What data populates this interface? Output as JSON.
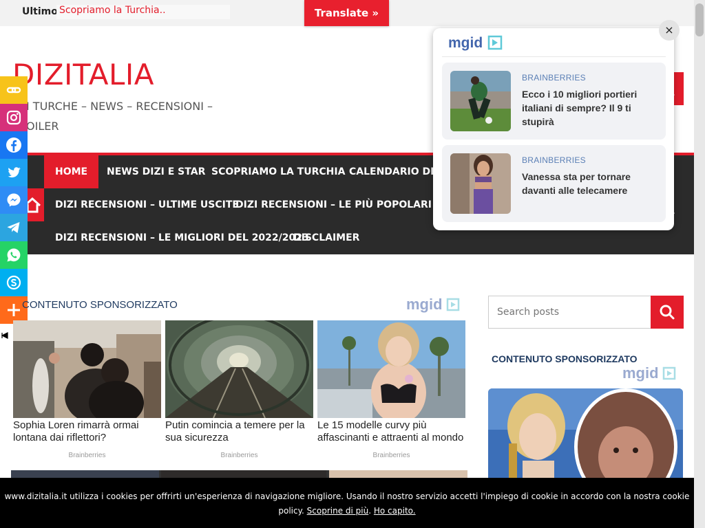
{
  "topbar": {
    "ticker_label": "Ultimo:",
    "ticker_link": "Scopriamo la Turchia..",
    "translate_label": "Translate »"
  },
  "header": {
    "logo": "DIZITALIA",
    "tagline_line1": "I TURCHE – NEWS – RECENSIONI –",
    "tagline_line2": "OILER"
  },
  "nav": {
    "items": [
      {
        "label": "HOME"
      },
      {
        "label": "NEWS DIZI E STAR"
      },
      {
        "label": "SCOPRIAMO LA TURCHIA"
      },
      {
        "label": "CALENDARIO DIZI TU"
      },
      {
        "label": "DIZI RECENSIONI – ULTIME USCITE"
      },
      {
        "label": "DIZI RECENSIONI – LE PIÙ POPOLARI"
      },
      {
        "label": "DIZI RECENSIONI – LE MIGLIORI DEL 2022/2023"
      },
      {
        "label": "DISCLAIMER"
      }
    ]
  },
  "social": [
    {
      "name": "copy-link",
      "color": "#f7c31a"
    },
    {
      "name": "instagram",
      "color": "#d6307a"
    },
    {
      "name": "facebook",
      "color": "#1877f2"
    },
    {
      "name": "twitter",
      "color": "#1da1f2"
    },
    {
      "name": "messenger",
      "color": "#2f8cf5"
    },
    {
      "name": "telegram",
      "color": "#2ca5e0"
    },
    {
      "name": "whatsapp",
      "color": "#25d366"
    },
    {
      "name": "skype",
      "color": "#00aff0"
    },
    {
      "name": "more",
      "color": "#ff6a1a"
    }
  ],
  "sponsored": {
    "label": "CONTENUTO SPONSORIZZATO",
    "logo": "mgid",
    "cards": [
      {
        "title": "Sophia Loren rimarrà ormai lontana dai riflettori?",
        "source": "Brainberries"
      },
      {
        "title": "Putin comincia a temere per la sua sicurezza",
        "source": "Brainberries"
      },
      {
        "title": "Le 15 modelle curvy più affascinanti e attraenti al mondo",
        "source": "Brainberries"
      }
    ]
  },
  "sidebar": {
    "search_placeholder": "Search posts",
    "sponsored_label": "CONTENUTO SPONSORIZZATO",
    "logo": "mgid"
  },
  "popup": {
    "logo": "mgid",
    "close": "×",
    "cards": [
      {
        "source": "BRAINBERRIES",
        "title": "Ecco i 10 migliori portieri italiani di sempre? Il 9 ti stupirà"
      },
      {
        "source": "BRAINBERRIES",
        "title": "Vanessa sta per tornare davanti alle telecamere"
      }
    ]
  },
  "cookie": {
    "text": "www.dizitalia.it utilizza i cookies per offrirti un'esperienza di navigazione migliore. Usando il nostro servizio accetti l'impiego di cookie in accordo con la nostra cookie policy.",
    "more_link": "Scoprine di più",
    "separator": ".",
    "accept_link": "Ho capito."
  },
  "colors": {
    "accent": "#e31d2b",
    "nav_bg": "#2b2b2b",
    "mgid_blue": "#4366ad",
    "mgid_teal": "#5fc9d8"
  }
}
